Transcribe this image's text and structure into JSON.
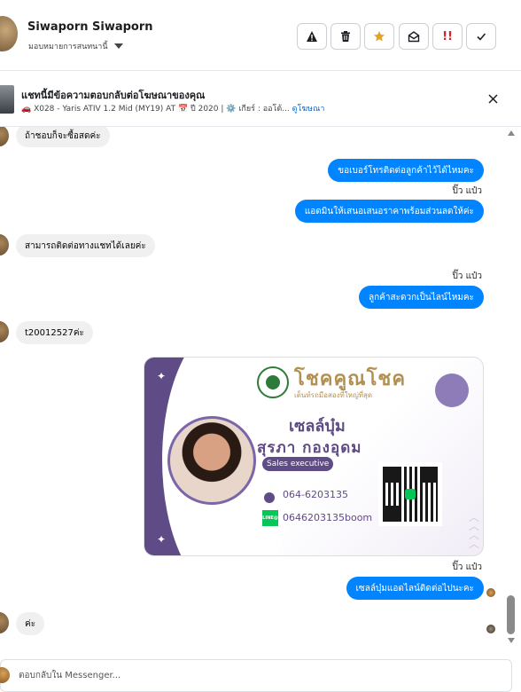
{
  "header": {
    "name": "Siwaporn Siwaporn",
    "assign_label": "มอบหมายการสนทนานี้",
    "actions": [
      "report",
      "delete",
      "star",
      "mark-unread",
      "important",
      "done"
    ],
    "action_accent": "#e5a323",
    "important_label": "!!"
  },
  "ad": {
    "title": "แชทนี้มีข้อความตอบกลับต่อโฆษณาของคุณ",
    "subtitle": "🚗 X028 - Yaris ATIV 1.2 Mid (MY19) AT 📅 ปี 2020 | ⚙️ เกียร์ : ออโต้...",
    "link": "ดูโฆษณา"
  },
  "messages": {
    "m1": "ถ้าชอบก็จะซื้อสดค่ะ",
    "m2": "ขอเบอร์โทรติดต่อลูกค้าไว้ได้ไหมคะ",
    "sender1": "ปิ๊ว แป๋ว",
    "m3": "แอดมินให้เสนอเสนอราคาพร้อมส่วนลดให้ค่ะ",
    "m4": "สามารถติดต่อทางแชทได้เลยค่ะ",
    "sender2": "ปิ๊ว แป๋ว",
    "m5": "ลูกค้าสะดวกเป็นไลน์ไหมคะ",
    "m6": "t20012527ค่ะ",
    "sender3": "ปิ๊ว แป๋ว",
    "m7": "เซลล์บุ๋มแอดไลน์ติดต่อไปนะคะ",
    "m8": "ค่ะ"
  },
  "card": {
    "brand": "โชคคูณโชค",
    "slogan": "เต็นท์รถมือสองที่ใหญ่ที่สุด",
    "nickname": "เซลล์บุ๋ม",
    "fullname": "สุรภา  กองอุดม",
    "role": "Sales executive",
    "phone": "064-6203135",
    "line_badge": "LINE@",
    "line_id": "0646203135boom"
  },
  "composer": {
    "placeholder": "ตอบกลับใน Messenger..."
  },
  "colors": {
    "outgoing": "#0084ff",
    "incoming": "#f0f0f0",
    "card_purple": "#5f4b86"
  }
}
